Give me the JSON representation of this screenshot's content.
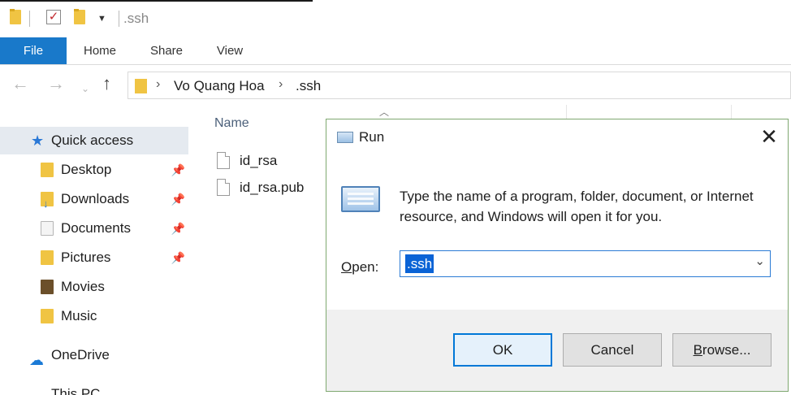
{
  "window": {
    "title": ".ssh"
  },
  "ribbon": {
    "tabs": [
      {
        "label": "File"
      },
      {
        "label": "Home"
      },
      {
        "label": "Share"
      },
      {
        "label": "View"
      }
    ]
  },
  "address": {
    "crumbs": [
      "Vo Quang Hoa",
      ".ssh"
    ]
  },
  "navpane": {
    "quick_access": "Quick access",
    "items": [
      {
        "label": "Desktop",
        "pinned": true
      },
      {
        "label": "Downloads",
        "pinned": true
      },
      {
        "label": "Documents",
        "pinned": true
      },
      {
        "label": "Pictures",
        "pinned": true
      },
      {
        "label": "Movies",
        "pinned": false
      },
      {
        "label": "Music",
        "pinned": false
      }
    ],
    "onedrive": "OneDrive",
    "this_pc": "This PC"
  },
  "content": {
    "column_name": "Name",
    "files": [
      "id_rsa",
      "id_rsa.pub"
    ]
  },
  "run_dialog": {
    "title": "Run",
    "description": "Type the name of a program, folder, document, or Internet resource, and Windows will open it for you.",
    "open_label_first": "O",
    "open_label_rest": "pen:",
    "open_value": ".ssh",
    "ok_label": "OK",
    "cancel_label": "Cancel",
    "browse_label_first": "B",
    "browse_label_rest": "rowse..."
  }
}
